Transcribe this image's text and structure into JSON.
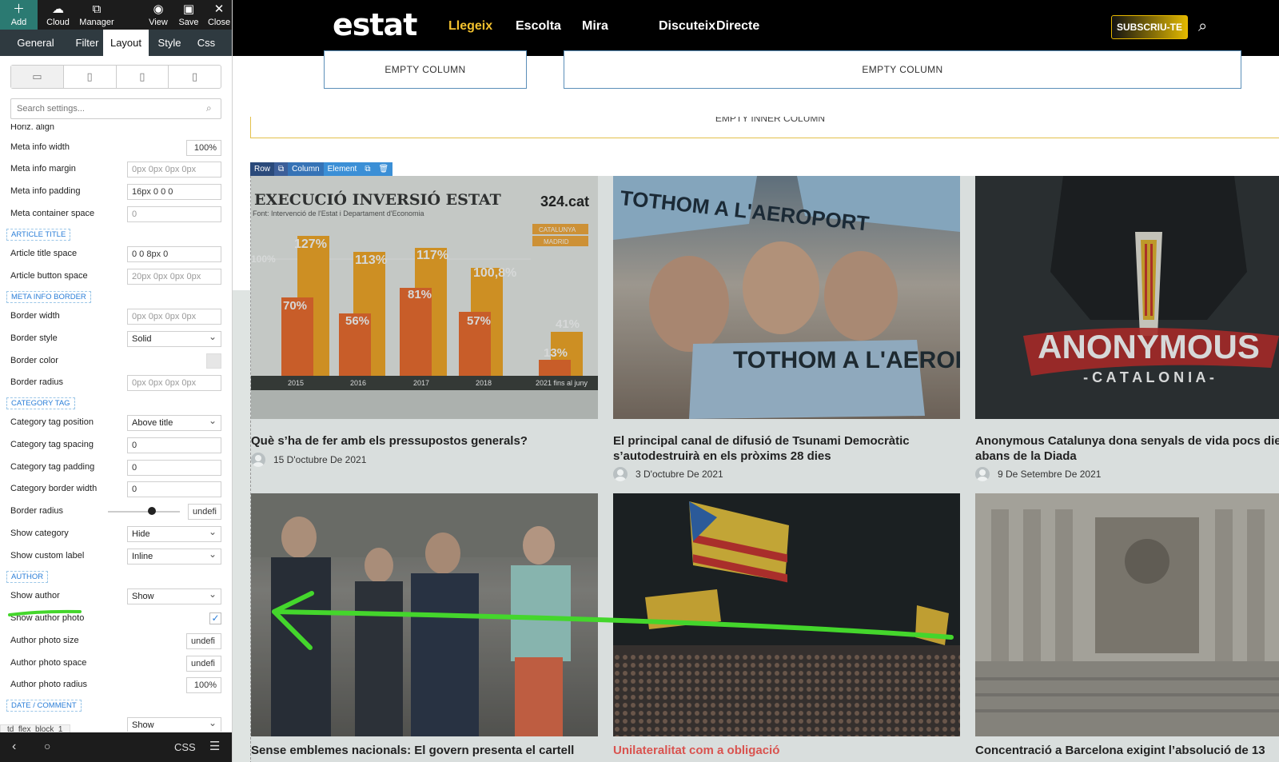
{
  "toolbar": {
    "add": "Add",
    "cloud": "Cloud",
    "manager": "Manager",
    "view": "View",
    "save": "Save",
    "close": "Close"
  },
  "tabs": [
    "General",
    "Filter",
    "Layout",
    "Style",
    "Css"
  ],
  "search": {
    "placeholder": "Search settings..."
  },
  "settings": {
    "horiz_align": "Horiz. align",
    "meta_info_width": {
      "label": "Meta info width",
      "value": "100%"
    },
    "meta_info_margin": {
      "label": "Meta info margin",
      "value": "0px 0px 0px 0px"
    },
    "meta_info_padding": {
      "label": "Meta info padding",
      "value": "16px 0 0 0"
    },
    "meta_container_space": {
      "label": "Meta container space",
      "value": "0"
    },
    "sec_article_title": "ARTICLE TITLE",
    "article_title_space": {
      "label": "Article title space",
      "value": "0 0 8px 0"
    },
    "article_button_space": {
      "label": "Article button space",
      "value": "20px 0px 0px 0px"
    },
    "sec_meta_info_border": "META INFO BORDER",
    "border_width": {
      "label": "Border width",
      "value": "0px 0px 0px 0px"
    },
    "border_style": {
      "label": "Border style",
      "value": "Solid"
    },
    "border_color": {
      "label": "Border color"
    },
    "border_radius": {
      "label": "Border radius",
      "value": "0px 0px 0px 0px"
    },
    "sec_category_tag": "CATEGORY TAG",
    "category_tag_position": {
      "label": "Category tag position",
      "value": "Above title"
    },
    "category_tag_spacing": {
      "label": "Category tag spacing",
      "value": "0"
    },
    "category_tag_padding": {
      "label": "Category tag padding",
      "value": "0"
    },
    "category_border_width": {
      "label": "Category border width",
      "value": "0"
    },
    "cat_border_radius": {
      "label": "Border radius",
      "value": "undefi"
    },
    "show_category": {
      "label": "Show category",
      "value": "Hide"
    },
    "show_custom_label": {
      "label": "Show custom label",
      "value": "Inline"
    },
    "sec_author": "AUTHOR",
    "show_author": {
      "label": "Show author",
      "value": "Show"
    },
    "show_author_photo": {
      "label": "Show author photo"
    },
    "author_photo_size": {
      "label": "Author photo size",
      "value": "undefi"
    },
    "author_photo_space": {
      "label": "Author photo space",
      "value": "undefi"
    },
    "author_photo_radius": {
      "label": "Author photo radius",
      "value": "100%"
    },
    "sec_date_comment": "DATE / COMMENT",
    "date_show": {
      "value": "Show"
    }
  },
  "block_name": "td_flex_block_1",
  "bottom": {
    "css": "CSS"
  },
  "site": {
    "logo": "estat",
    "nav": [
      "Llegeix",
      "Escolta",
      "Mira",
      "Discuteix",
      "Directe"
    ],
    "subscribe": "SUBSCRIU-TE",
    "empty_column": "EMPTY COLUMN",
    "empty_inner_column": "EMPTY INNER COLUMN",
    "edit_toolbar": [
      "Row",
      "Column",
      "Element"
    ]
  },
  "articles": [
    {
      "title": "Què s’ha de fer amb els pressupostos generals?",
      "date": "15 D'octubre De 2021"
    },
    {
      "title": "El principal canal de difusió de Tsunami Democràtic s’autodestruirà en els pròxims 28 dies",
      "date": "3 D'octubre De 2021"
    },
    {
      "title": "Anonymous Catalunya dona senyals de vida pocs dies abans de la Diada",
      "date": "9 De Setembre De 2021"
    },
    {
      "title": "Sense emblemes nacionals: El govern presenta el cartell"
    },
    {
      "title": "Unilateralitat com a obligació"
    },
    {
      "title": "Concentració a Barcelona exigint l’absolució de 13"
    }
  ],
  "image_text": {
    "chart_title": "EXECUCIÓ INVERSIÓ ESTAT",
    "chart_source": "Font: Intervenció de l'Estat i Departament d'Economia",
    "chart_brand": "324.cat",
    "legend": [
      "CATALUNYA",
      "MADRID"
    ],
    "chart_y": "100%",
    "bars": [
      {
        "year": "2015",
        "madrid": "127%",
        "catalunya": "70%"
      },
      {
        "year": "2016",
        "madrid": "113%",
        "catalunya": "56%"
      },
      {
        "year": "2017",
        "madrid": "117%",
        "catalunya": "81%"
      },
      {
        "year": "2018",
        "madrid": "100,8%",
        "catalunya": "57%"
      },
      {
        "year": "2021 fins al juny",
        "madrid": "41%",
        "catalunya": "13%"
      }
    ],
    "banner_top": "TOTHOM A L'AEROPORT",
    "banner_main": "TOTHOM A L'AEROPORT",
    "anon": "ANONYMOUS",
    "anon_sub": "- C A T A L O N I A -"
  },
  "colors": {
    "accent": "#2b7a72",
    "nav_active": "#f2c12e",
    "annotation": "#44d62c",
    "link_red": "#d9534f"
  }
}
